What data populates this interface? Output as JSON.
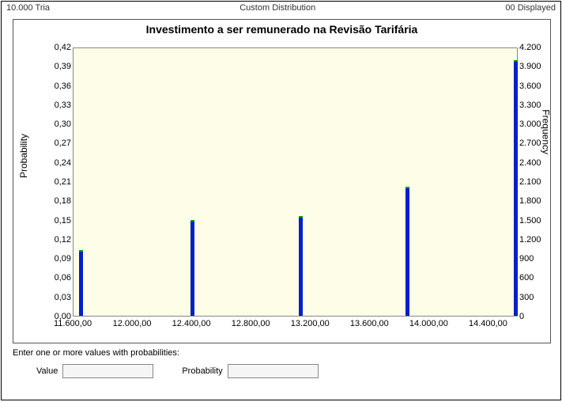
{
  "header": {
    "left": "10.000 Tria",
    "center": "Custom Distribution",
    "right": "00 Displayed"
  },
  "chart": {
    "title": "Investimento a ser remunerado na Revisão Tarifária",
    "y_left_label": "Probability",
    "y_right_label": "Frequency"
  },
  "chart_data": {
    "type": "bar",
    "title": "Investimento a ser remunerado na Revisão Tarifária",
    "xlabel": "",
    "ylabel_left": "Probability",
    "ylabel_right": "Frequency",
    "xlim": [
      11600,
      14600
    ],
    "ylim_left": [
      0,
      0.42
    ],
    "ylim_right": [
      0,
      4200
    ],
    "x_ticks": [
      "11.600,00",
      "12.000,00",
      "12.400,00",
      "12.800,00",
      "13.200,00",
      "13.600,00",
      "14.000,00",
      "14.400,00"
    ],
    "y_left_ticks": [
      "0,00",
      "0,03",
      "0,06",
      "0,09",
      "0,12",
      "0,15",
      "0,18",
      "0,21",
      "0,24",
      "0,27",
      "0,30",
      "0,33",
      "0,36",
      "0,39",
      "0,42"
    ],
    "y_right_ticks": [
      "0",
      "300",
      "600",
      "900",
      "1.200",
      "1.500",
      "1.800",
      "2.100",
      "2.400",
      "2.700",
      "3.000",
      "3.300",
      "3.600",
      "3.900",
      "4.200"
    ],
    "series": [
      {
        "name": "Probability",
        "points": [
          {
            "x": 11650,
            "y": 0.103
          },
          {
            "x": 12400,
            "y": 0.149
          },
          {
            "x": 13130,
            "y": 0.156
          },
          {
            "x": 13850,
            "y": 0.201
          },
          {
            "x": 14580,
            "y": 0.399
          }
        ]
      }
    ]
  },
  "form": {
    "prompt": "Enter one or more values with probabilities:",
    "value_label": "Value",
    "value_input": "",
    "prob_label": "Probability",
    "prob_input": ""
  }
}
